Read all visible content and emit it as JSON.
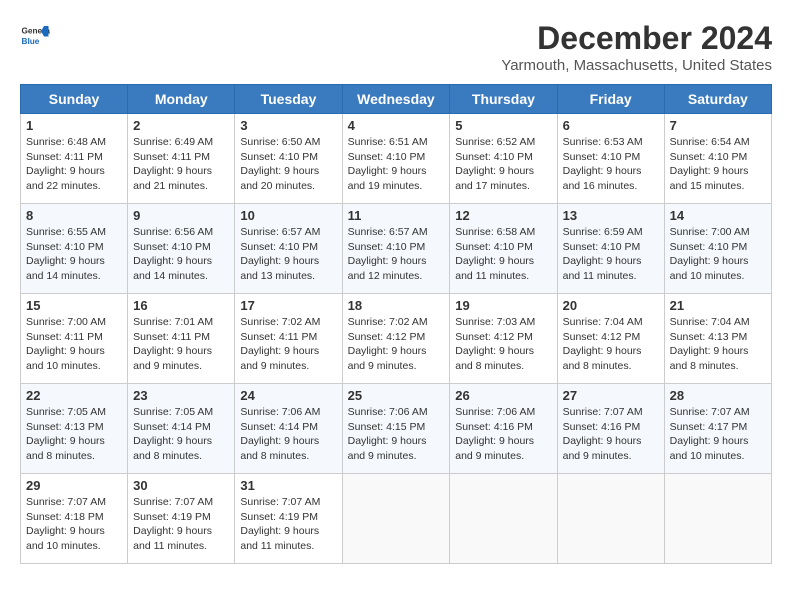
{
  "header": {
    "logo_general": "General",
    "logo_blue": "Blue",
    "month_year": "December 2024",
    "location": "Yarmouth, Massachusetts, United States"
  },
  "days_of_week": [
    "Sunday",
    "Monday",
    "Tuesday",
    "Wednesday",
    "Thursday",
    "Friday",
    "Saturday"
  ],
  "weeks": [
    [
      {
        "day": "1",
        "sunrise": "6:48 AM",
        "sunset": "4:11 PM",
        "daylight": "9 hours and 22 minutes."
      },
      {
        "day": "2",
        "sunrise": "6:49 AM",
        "sunset": "4:11 PM",
        "daylight": "9 hours and 21 minutes."
      },
      {
        "day": "3",
        "sunrise": "6:50 AM",
        "sunset": "4:10 PM",
        "daylight": "9 hours and 20 minutes."
      },
      {
        "day": "4",
        "sunrise": "6:51 AM",
        "sunset": "4:10 PM",
        "daylight": "9 hours and 19 minutes."
      },
      {
        "day": "5",
        "sunrise": "6:52 AM",
        "sunset": "4:10 PM",
        "daylight": "9 hours and 17 minutes."
      },
      {
        "day": "6",
        "sunrise": "6:53 AM",
        "sunset": "4:10 PM",
        "daylight": "9 hours and 16 minutes."
      },
      {
        "day": "7",
        "sunrise": "6:54 AM",
        "sunset": "4:10 PM",
        "daylight": "9 hours and 15 minutes."
      }
    ],
    [
      {
        "day": "8",
        "sunrise": "6:55 AM",
        "sunset": "4:10 PM",
        "daylight": "9 hours and 14 minutes."
      },
      {
        "day": "9",
        "sunrise": "6:56 AM",
        "sunset": "4:10 PM",
        "daylight": "9 hours and 14 minutes."
      },
      {
        "day": "10",
        "sunrise": "6:57 AM",
        "sunset": "4:10 PM",
        "daylight": "9 hours and 13 minutes."
      },
      {
        "day": "11",
        "sunrise": "6:57 AM",
        "sunset": "4:10 PM",
        "daylight": "9 hours and 12 minutes."
      },
      {
        "day": "12",
        "sunrise": "6:58 AM",
        "sunset": "4:10 PM",
        "daylight": "9 hours and 11 minutes."
      },
      {
        "day": "13",
        "sunrise": "6:59 AM",
        "sunset": "4:10 PM",
        "daylight": "9 hours and 11 minutes."
      },
      {
        "day": "14",
        "sunrise": "7:00 AM",
        "sunset": "4:10 PM",
        "daylight": "9 hours and 10 minutes."
      }
    ],
    [
      {
        "day": "15",
        "sunrise": "7:00 AM",
        "sunset": "4:11 PM",
        "daylight": "9 hours and 10 minutes."
      },
      {
        "day": "16",
        "sunrise": "7:01 AM",
        "sunset": "4:11 PM",
        "daylight": "9 hours and 9 minutes."
      },
      {
        "day": "17",
        "sunrise": "7:02 AM",
        "sunset": "4:11 PM",
        "daylight": "9 hours and 9 minutes."
      },
      {
        "day": "18",
        "sunrise": "7:02 AM",
        "sunset": "4:12 PM",
        "daylight": "9 hours and 9 minutes."
      },
      {
        "day": "19",
        "sunrise": "7:03 AM",
        "sunset": "4:12 PM",
        "daylight": "9 hours and 8 minutes."
      },
      {
        "day": "20",
        "sunrise": "7:04 AM",
        "sunset": "4:12 PM",
        "daylight": "9 hours and 8 minutes."
      },
      {
        "day": "21",
        "sunrise": "7:04 AM",
        "sunset": "4:13 PM",
        "daylight": "9 hours and 8 minutes."
      }
    ],
    [
      {
        "day": "22",
        "sunrise": "7:05 AM",
        "sunset": "4:13 PM",
        "daylight": "9 hours and 8 minutes."
      },
      {
        "day": "23",
        "sunrise": "7:05 AM",
        "sunset": "4:14 PM",
        "daylight": "9 hours and 8 minutes."
      },
      {
        "day": "24",
        "sunrise": "7:06 AM",
        "sunset": "4:14 PM",
        "daylight": "9 hours and 8 minutes."
      },
      {
        "day": "25",
        "sunrise": "7:06 AM",
        "sunset": "4:15 PM",
        "daylight": "9 hours and 9 minutes."
      },
      {
        "day": "26",
        "sunrise": "7:06 AM",
        "sunset": "4:16 PM",
        "daylight": "9 hours and 9 minutes."
      },
      {
        "day": "27",
        "sunrise": "7:07 AM",
        "sunset": "4:16 PM",
        "daylight": "9 hours and 9 minutes."
      },
      {
        "day": "28",
        "sunrise": "7:07 AM",
        "sunset": "4:17 PM",
        "daylight": "9 hours and 10 minutes."
      }
    ],
    [
      {
        "day": "29",
        "sunrise": "7:07 AM",
        "sunset": "4:18 PM",
        "daylight": "9 hours and 10 minutes."
      },
      {
        "day": "30",
        "sunrise": "7:07 AM",
        "sunset": "4:19 PM",
        "daylight": "9 hours and 11 minutes."
      },
      {
        "day": "31",
        "sunrise": "7:07 AM",
        "sunset": "4:19 PM",
        "daylight": "9 hours and 11 minutes."
      },
      null,
      null,
      null,
      null
    ]
  ]
}
